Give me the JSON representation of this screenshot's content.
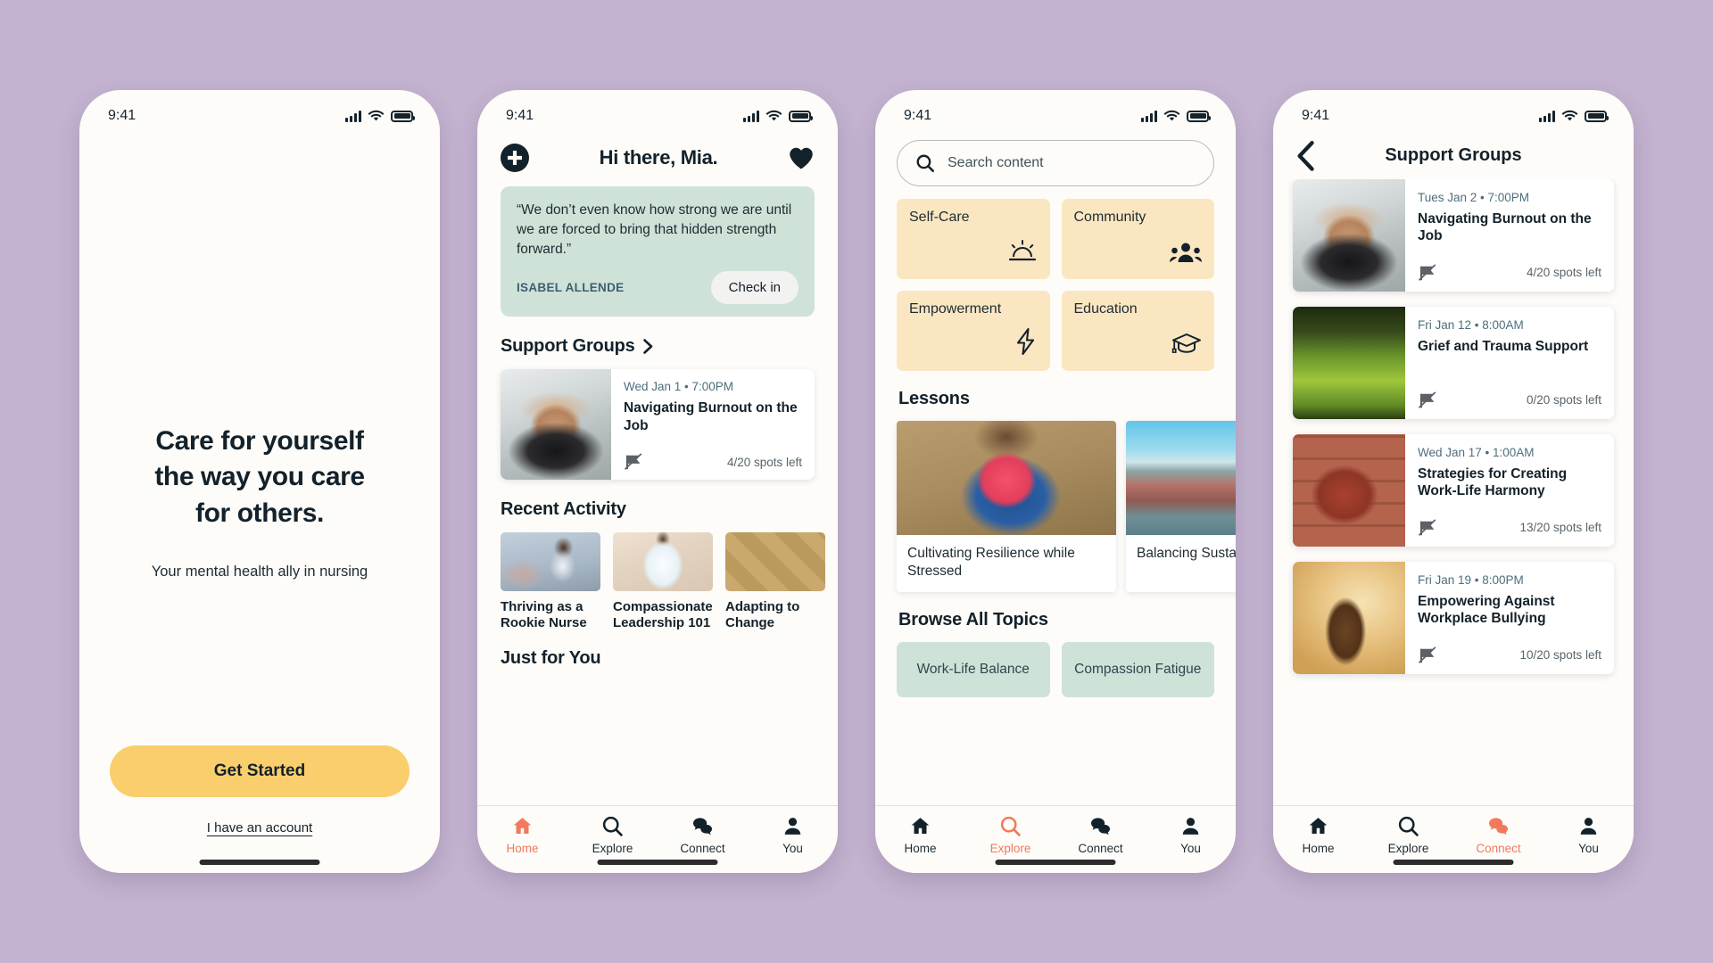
{
  "status": {
    "time": "9:41"
  },
  "screens": {
    "onboarding": {
      "headline_line1": "Care for yourself",
      "headline_line2": "the way you care",
      "headline_line3": "for others.",
      "subtitle": "Your mental health ally in nursing",
      "primary_button": "Get Started",
      "account_link": "I  have an account"
    },
    "home": {
      "greeting": "Hi there, Mia.",
      "quote": "“We don’t even know how strong we are until we are forced to bring that hidden strength forward.”",
      "quote_author": "ISABEL ALLENDE",
      "checkin_button": "Check in",
      "support_groups_title": "Support Groups",
      "group": {
        "date": "Wed Jan 1 • 7:00PM",
        "name": "Navigating Burnout on the Job",
        "spots": "4/20 spots left"
      },
      "recent_activity_title": "Recent Activity",
      "recent_activity": [
        {
          "title": "Thriving as a Rookie Nurse"
        },
        {
          "title": "Compassionate Leadership 101"
        },
        {
          "title": "Adapting to Change"
        }
      ],
      "just_for_you_title": "Just for You"
    },
    "explore": {
      "search_placeholder": "Search content",
      "categories": [
        {
          "label": "Self-Care",
          "icon": "sunrise-icon"
        },
        {
          "label": "Community",
          "icon": "people-icon"
        },
        {
          "label": "Empowerment",
          "icon": "bolt-icon"
        },
        {
          "label": "Education",
          "icon": "graduation-cap-icon"
        }
      ],
      "lessons_title": "Lessons",
      "lessons": [
        {
          "title": "Cultivating Resilience while Stressed"
        },
        {
          "title": "Balancing Sustaina"
        }
      ],
      "browse_title": "Browse All Topics",
      "topics": [
        {
          "label": "Work-Life Balance"
        },
        {
          "label": "Compassion Fatigue"
        }
      ]
    },
    "support_groups": {
      "title": "Support Groups",
      "items": [
        {
          "date": "Tues Jan 2 • 7:00PM",
          "name": "Navigating Burnout on the Job",
          "spots": "4/20 spots left"
        },
        {
          "date": "Fri Jan 12 • 8:00AM",
          "name": "Grief and Trauma Support",
          "spots": "0/20 spots left"
        },
        {
          "date": "Wed Jan 17 • 1:00AM",
          "name": "Strategies for Creating Work-Life Harmony",
          "spots": "13/20 spots left"
        },
        {
          "date": "Fri Jan 19 • 8:00PM",
          "name": "Empowering Against Workplace Bullying",
          "spots": "10/20 spots left"
        }
      ]
    }
  },
  "tabbar": {
    "items": [
      {
        "label": "Home",
        "icon": "home-icon"
      },
      {
        "label": "Explore",
        "icon": "search-icon"
      },
      {
        "label": "Connect",
        "icon": "chat-bubbles-icon"
      },
      {
        "label": "You",
        "icon": "person-icon"
      }
    ],
    "active": {
      "home": "Home",
      "explore": "Explore",
      "support_groups": "Connect"
    }
  },
  "colors": {
    "background": "#c3b3d0",
    "accent_yellow": "#fbce6d",
    "accent_orange": "#f4785c",
    "mint": "#cfe2d7",
    "cream": "#fbe6c2",
    "ink": "#13212a"
  }
}
